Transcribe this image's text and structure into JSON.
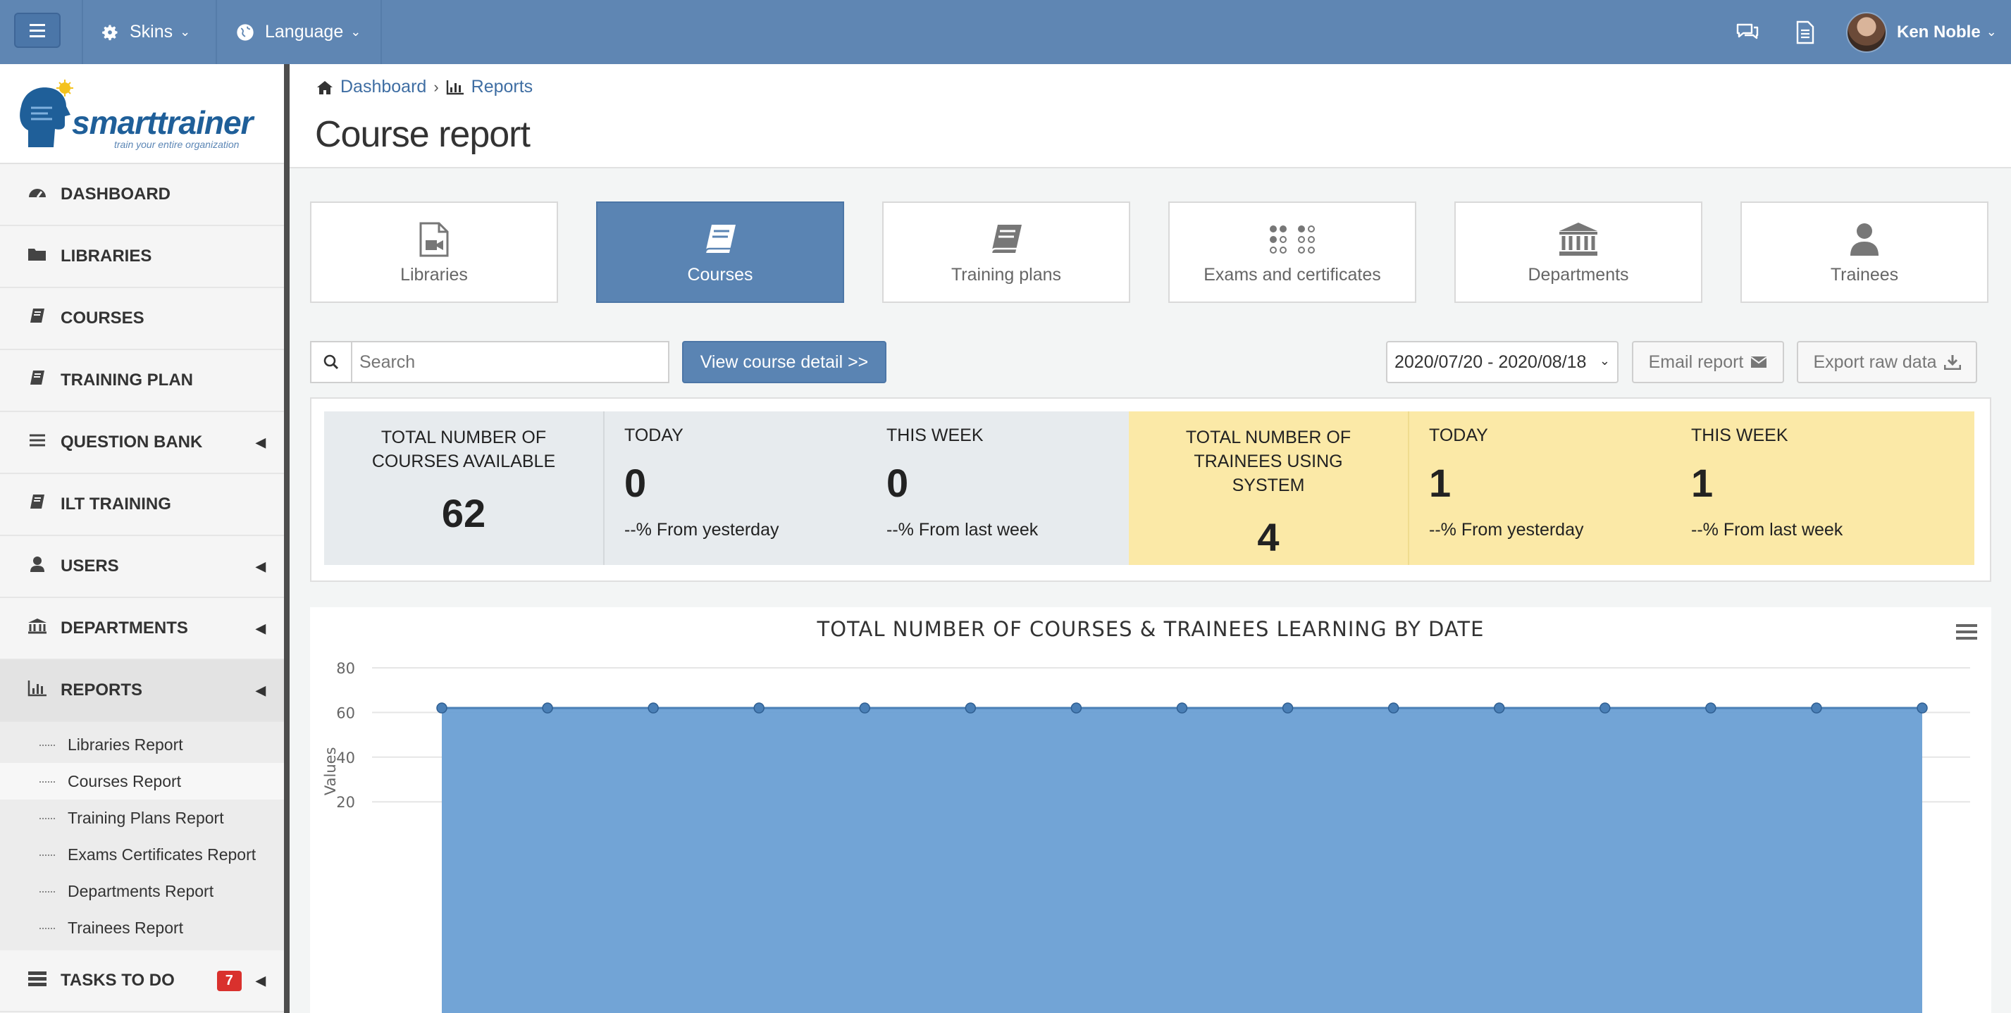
{
  "topbar": {
    "skins_label": "Skins",
    "language_label": "Language",
    "user_name": "Ken Noble"
  },
  "logo": {
    "word": "smarttrainer",
    "tagline": "train your entire organization"
  },
  "sidebar": {
    "items": [
      {
        "label": "DASHBOARD",
        "icon": "dashboard-icon"
      },
      {
        "label": "LIBRARIES",
        "icon": "folder-icon"
      },
      {
        "label": "COURSES",
        "icon": "book-icon"
      },
      {
        "label": "TRAINING PLAN",
        "icon": "book-icon"
      },
      {
        "label": "QUESTION BANK",
        "icon": "list-icon"
      },
      {
        "label": "ILT TRAINING",
        "icon": "book-icon"
      },
      {
        "label": "USERS",
        "icon": "user-icon"
      },
      {
        "label": "DEPARTMENTS",
        "icon": "bank-icon"
      },
      {
        "label": "REPORTS",
        "icon": "bar-chart-icon"
      }
    ],
    "reports_sub": [
      "Libraries Report",
      "Courses Report",
      "Training Plans Report",
      "Exams Certificates Report",
      "Departments Report",
      "Trainees Report"
    ],
    "tasks_label": "TASKS TO DO",
    "tasks_count": "7"
  },
  "breadcrumb": {
    "home": "Dashboard",
    "current": "Reports"
  },
  "page_title": "Course report",
  "tiles": [
    {
      "label": "Libraries",
      "icon": "video-file-icon"
    },
    {
      "label": "Courses",
      "icon": "book-icon"
    },
    {
      "label": "Training plans",
      "icon": "book-icon"
    },
    {
      "label": "Exams and certificates",
      "icon": "dots-grid-icon"
    },
    {
      "label": "Departments",
      "icon": "bank-icon"
    },
    {
      "label": "Trainees",
      "icon": "user-icon"
    }
  ],
  "toolbar": {
    "search_placeholder": "Search",
    "view_detail_label": "View course detail >>",
    "date_range": "2020/07/20 - 2020/08/18",
    "email_label": "Email report",
    "export_label": "Export raw data"
  },
  "stats": {
    "courses": {
      "title": "TOTAL NUMBER OF COURSES AVAILABLE",
      "total": "62",
      "today_label": "TODAY",
      "today_value": "0",
      "today_delta": "--% From yesterday",
      "week_label": "THIS WEEK",
      "week_value": "0",
      "week_delta": "--% From last week"
    },
    "trainees": {
      "title": "TOTAL NUMBER OF TRAINEES USING SYSTEM",
      "total": "4",
      "today_label": "TODAY",
      "today_value": "1",
      "today_delta": "--% From yesterday",
      "week_label": "THIS WEEK",
      "week_value": "1",
      "week_delta": "--% From last week"
    }
  },
  "chart_data": {
    "type": "area",
    "title": "TOTAL NUMBER OF COURSES & TRAINEES LEARNING BY DATE",
    "ylabel": "Values",
    "yticks": [
      20,
      40,
      60,
      80
    ],
    "ylim": [
      0,
      80
    ],
    "series": [
      {
        "values": [
          62,
          62,
          62,
          62,
          62,
          62,
          62,
          62,
          62,
          62,
          62,
          62,
          62,
          62,
          62
        ]
      }
    ],
    "color": "#6a9fd4"
  }
}
